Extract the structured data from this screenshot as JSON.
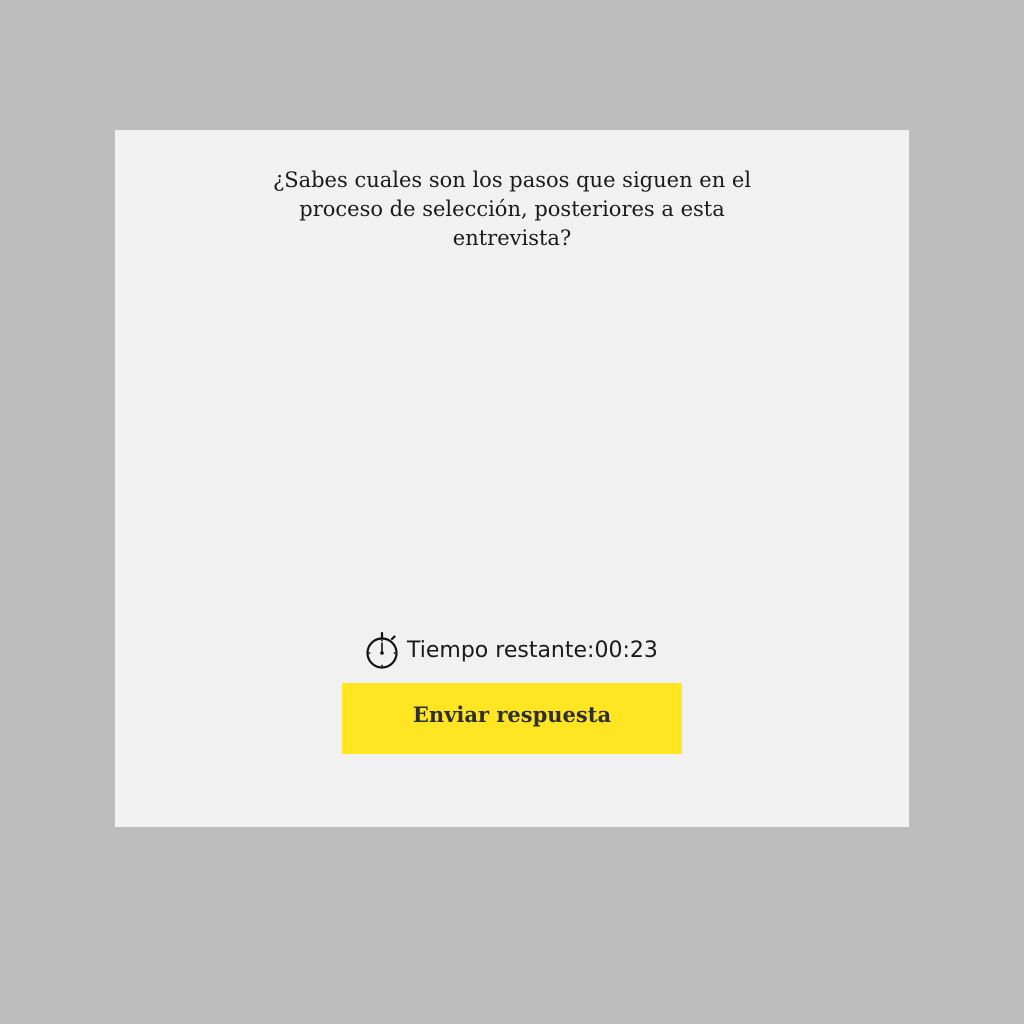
{
  "question": {
    "text": "¿Sabes cuales son los pasos que siguen en el proceso de selección, posteriores a esta entrevista?"
  },
  "timer": {
    "icon": "stopwatch-icon",
    "label": "Tiempo restante:",
    "value": "00:23"
  },
  "submit": {
    "label": "Enviar respuesta"
  },
  "colors": {
    "background": "#bdbdbd",
    "card": "#f1f1f1",
    "accent": "#ffe522",
    "text": "#1a1a1a"
  }
}
